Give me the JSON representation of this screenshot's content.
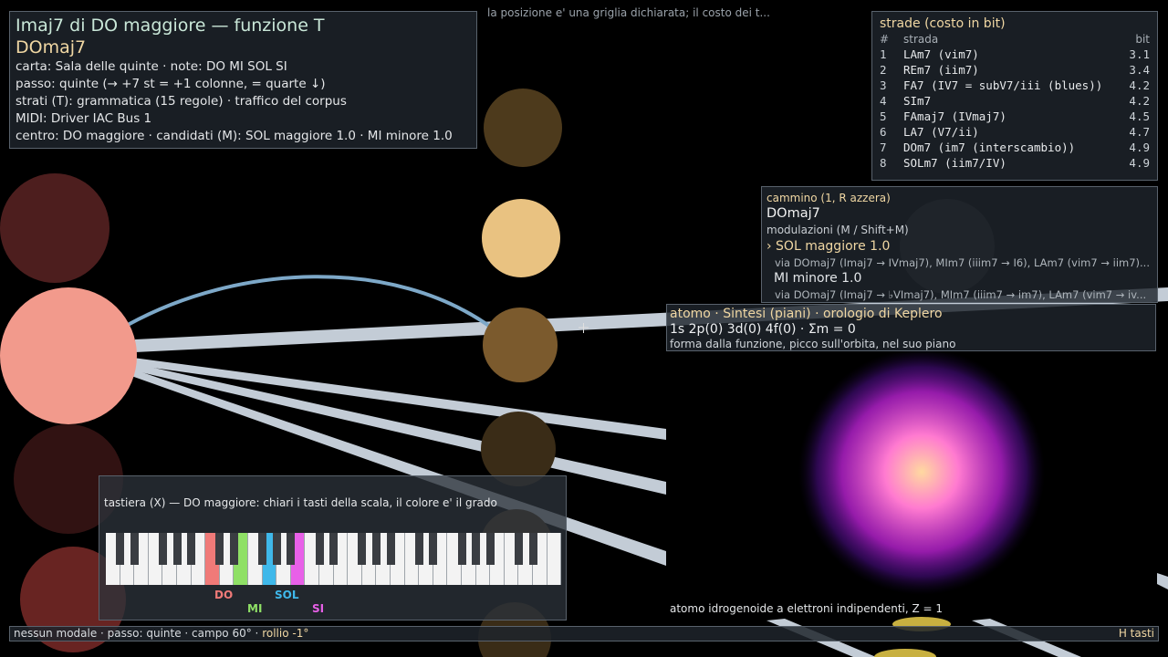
{
  "info": {
    "title": "Imaj7 di DO maggiore — funzione T",
    "chord": "DOmaj7",
    "lines": [
      "carta: Sala delle quinte   ·   note: DO MI SOL SI",
      "passo: quinte (→ +7 st = +1 colonne, = quarte ↓)",
      "strati (T): grammatica (15 regole) · traffico del corpus",
      "MIDI: Driver IAC Bus 1",
      "centro: DO maggiore   ·   candidati (M): SOL maggiore 1.0 · MI minore 1.0"
    ]
  },
  "hint": "la posizione e' una griglia dichiarata; il costo dei t...",
  "strade": {
    "title": "strade (costo in bit)",
    "headers": {
      "n": "#",
      "strada": "strada",
      "bit": "bit"
    },
    "rows": [
      {
        "n": "1",
        "strada": "LAm7 (vim7)",
        "bit": "3.1"
      },
      {
        "n": "2",
        "strada": "REm7 (iim7)",
        "bit": "3.4"
      },
      {
        "n": "3",
        "strada": "FA7 (IV7 = subV7/iii (blues))",
        "bit": "4.2"
      },
      {
        "n": "4",
        "strada": "SIm7",
        "bit": "4.2"
      },
      {
        "n": "5",
        "strada": "FAmaj7 (IVmaj7)",
        "bit": "4.5"
      },
      {
        "n": "6",
        "strada": "LA7 (V7/ii)",
        "bit": "4.7"
      },
      {
        "n": "7",
        "strada": "DOm7 (im7 (interscambio))",
        "bit": "4.9"
      },
      {
        "n": "8",
        "strada": "SOLm7 (iim7/IV)",
        "bit": "4.9"
      }
    ]
  },
  "cammino": {
    "title": "cammino (1, R azzera)",
    "chord": "DOmaj7",
    "modulazioni": "modulazioni (M / Shift+M)",
    "mod1": "› SOL maggiore 1.0",
    "via1": "via DOmaj7 (Imaj7 → IVmaj7), MIm7 (iiim7 → I6), LAm7 (vim7 → iim7)...",
    "mod2": "MI minore 1.0",
    "via2": "via DOmaj7 (Imaj7 → ♭VImaj7), MIm7 (iiim7 → im7), LAm7 (vim7 → iv..."
  },
  "atomo": {
    "title": "atomo · Sintesi (piani) · orologio di Keplero",
    "config": "1s 2p(0) 3d(0) 4f(0) · Σm = 0",
    "sub": "forma dalla funzione, picco sull'orbita, nel suo piano"
  },
  "tastiera": {
    "title": "tastiera (X) — DO maggiore: chiari i tasti della scala, il colore e' il grado",
    "labels": [
      "DO",
      "MI",
      "SOL",
      "SI"
    ]
  },
  "atomo_note": "atomo idrogenoide a elettroni indipendenti, Z = 1",
  "status": {
    "left": "nessun modale  ·  passo: quinte  ·  campo 60°  ·",
    "roll": "rollio -1°",
    "right": "H tasti"
  },
  "colors": {
    "accent": "#f0d7a3",
    "title_green": "#c9e7d8",
    "do": "#f07a78",
    "mi": "#8fe066",
    "sol": "#3fb8ea",
    "si": "#e860e8"
  }
}
